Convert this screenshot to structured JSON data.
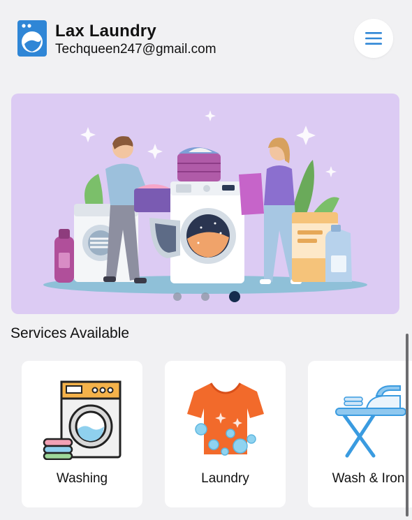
{
  "header": {
    "title": "Lax Laundry",
    "email": "Techqueen247@gmail.com",
    "logo_icon": "washing-machine-logo-icon",
    "menu_icon": "hamburger-menu-icon"
  },
  "banner": {
    "illustration": "laundry-room-illustration",
    "carousel": {
      "total": 3,
      "active": 3
    }
  },
  "services": {
    "title": "Services Available",
    "items": [
      {
        "label": "Washing",
        "icon": "washing-machine-icon"
      },
      {
        "label": "Laundry",
        "icon": "tshirt-icon"
      },
      {
        "label": "Wash & Iron",
        "icon": "ironing-board-icon"
      }
    ]
  },
  "colors": {
    "accent": "#2f86d6",
    "banner_bg": "#dccbf3",
    "active_dot": "#152c4d"
  }
}
